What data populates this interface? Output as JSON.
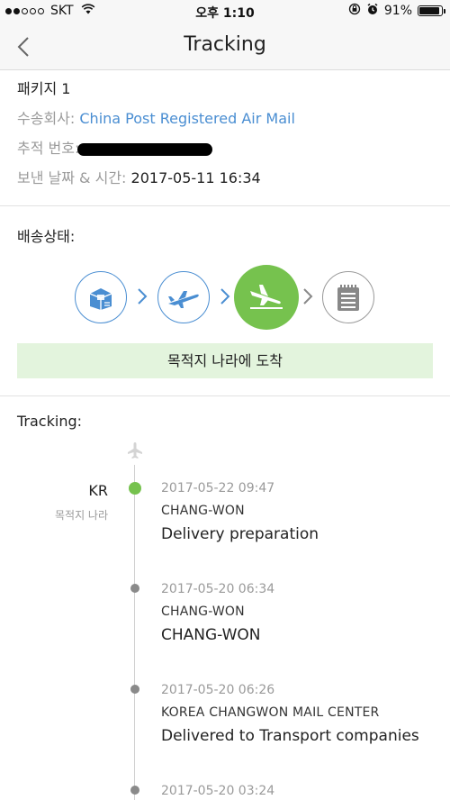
{
  "status_bar": {
    "carrier": "SKT",
    "time": "오후 1:10",
    "battery": "91%",
    "battery_level": 0.91
  },
  "nav": {
    "title": "Tracking"
  },
  "package": {
    "name": "패키지 1",
    "carrier_label": "수송회사:",
    "carrier_value": "China Post Registered Air Mail",
    "tracking_label": "추적 번호:",
    "sent_label": "보낸 날짜 & 시간:",
    "sent_value": "2017-05-11 16:34"
  },
  "delivery": {
    "label": "배송상태:",
    "steps": [
      {
        "icon": "package-icon",
        "state": "done"
      },
      {
        "icon": "plane-takeoff-icon",
        "state": "done"
      },
      {
        "icon": "plane-landing-icon",
        "state": "active"
      },
      {
        "icon": "notepad-icon",
        "state": "pending"
      }
    ],
    "status_text": "목적지 나라에 도착"
  },
  "tracking": {
    "title": "Tracking:",
    "country": "KR",
    "country_sub": "목적지 나라",
    "events": [
      {
        "time": "2017-05-22 09:47",
        "location": "CHANG-WON",
        "description": "Delivery preparation",
        "latest": true
      },
      {
        "time": "2017-05-20 06:34",
        "location": "CHANG-WON",
        "description": "CHANG-WON",
        "latest": false
      },
      {
        "time": "2017-05-20 06:26",
        "location": "KOREA CHANGWON MAIL CENTER",
        "description": "Delivered to Transport companies",
        "latest": false
      },
      {
        "time": "2017-05-20 03:24",
        "location": "",
        "description": "",
        "latest": false
      }
    ]
  },
  "colors": {
    "accent_blue": "#4a8ed2",
    "active_green": "#76c24e",
    "banner_bg": "#e3f4dd"
  }
}
